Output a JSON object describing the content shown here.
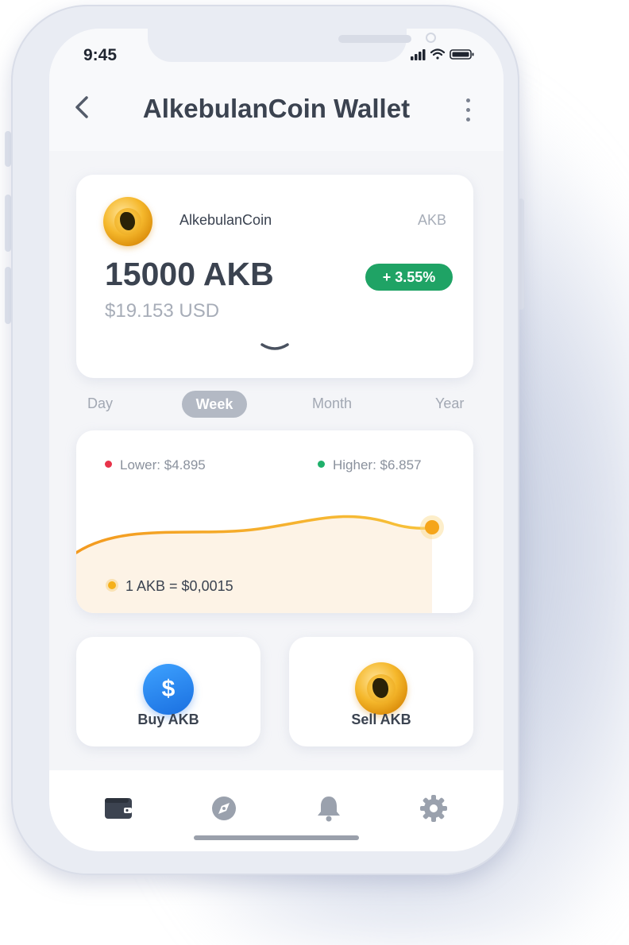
{
  "status_bar": {
    "time": "9:45"
  },
  "header": {
    "title": "AlkebulanCoin Wallet"
  },
  "balance": {
    "coin_name": "AlkebulanCoin",
    "ticker": "AKB",
    "amount": "15000 AKB",
    "change": "+ 3.55%",
    "usd_value": "$19.153 USD"
  },
  "periods": {
    "day": "Day",
    "week": "Week",
    "month": "Month",
    "year": "Year",
    "selected": "Week"
  },
  "chart": {
    "lower": "Lower: $4.895",
    "higher": "Higher: $6.857",
    "rate": "1 AKB = $0,0015"
  },
  "actions": {
    "buy": "Buy AKB",
    "sell": "Sell AKB"
  },
  "nav": [
    "wallet-icon",
    "compass-icon",
    "bell-icon",
    "gear-icon"
  ],
  "colors": {
    "positive": "#1fa365",
    "lower_dot": "#e8334a",
    "higher_dot": "#1fb06b",
    "line": "#f5a623",
    "accent_blue": "#1f7ff0"
  }
}
